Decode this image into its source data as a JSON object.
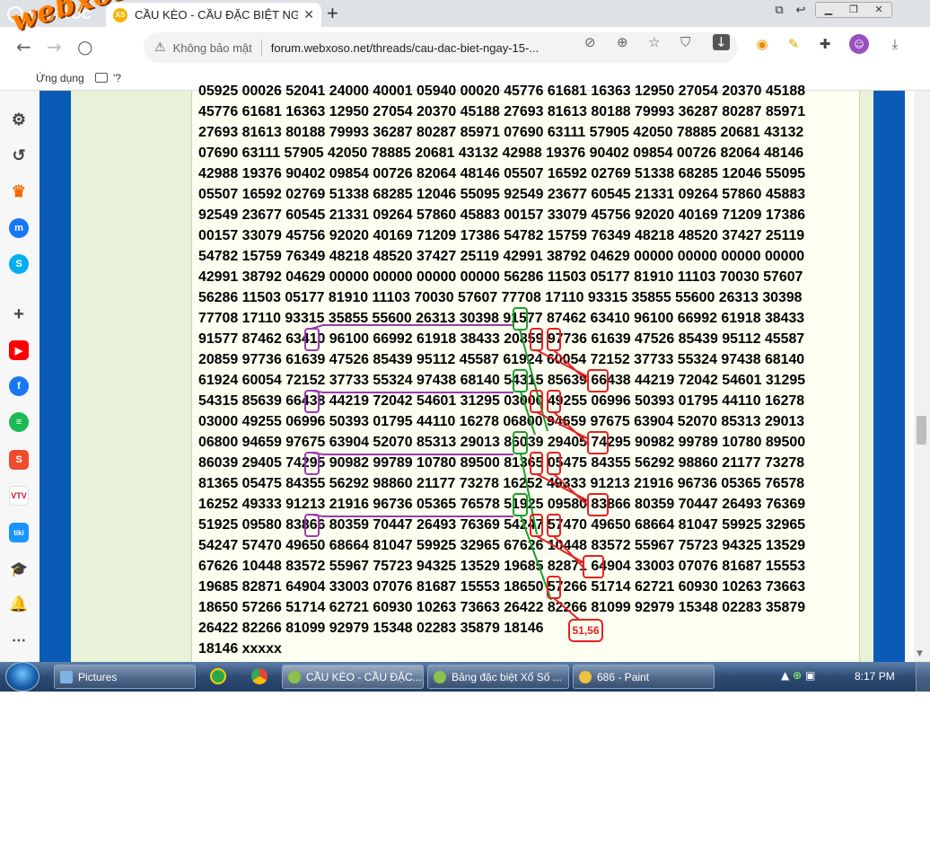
{
  "browser": {
    "name": "CỐC CỐC",
    "tab_title": "CẦU KÈO - CẦU ĐẶC BIỆT NG",
    "tab_favicon": "XS",
    "security_label": "Không bảo mật",
    "url": "forum.webxoso.net/threads/cau-dac-biet-ngay-15-...",
    "bookmark_label": "Ứng dụng",
    "bookmark_extra": "'?"
  },
  "watermark": "webxoso.net",
  "rows": [
    "05925 00026 52041 24000 40001 05940 00020 45776 61681 16363 12950 27054 20370 45188",
    "45776 61681 16363 12950 27054 20370 45188 27693 81613 80188 79993 36287 80287 85971",
    "27693 81613 80188 79993 36287 80287 85971 07690 63111 57905 42050 78885 20681 43132",
    "07690 63111 57905 42050 78885 20681 43132 42988 19376 90402 09854 00726 82064 48146",
    "42988 19376 90402 09854 00726 82064 48146 05507 16592 02769 51338 68285 12046 55095",
    "05507 16592 02769 51338 68285 12046 55095 92549 23677 60545 21331 09264 57860 45883",
    "92549 23677 60545 21331 09264 57860 45883 00157 33079 45756 92020 40169 71209 17386",
    "00157 33079 45756 92020 40169 71209 17386 54782 15759 76349 48218 48520 37427 25119",
    "54782 15759 76349 48218 48520 37427 25119 42991 38792 04629 00000 00000 00000 00000",
    "42991 38792 04629 00000 00000 00000 00000 56286 11503 05177 81910 11103 70030 57607",
    "56286 11503 05177 81910 11103 70030 57607 77708 17110 93315 35855 55600 26313 30398",
    "77708 17110 93315 35855 55600 26313 30398 91577 87462 63410 96100 66992 61918 38433",
    "91577 87462 63410 96100 66992 61918 38433 20859 97736 61639 47526 85439 95112 45587",
    "20859 97736 61639 47526 85439 95112 45587 61924 60054 72152 37733 55324 97438 68140",
    "61924 60054 72152 37733 55324 97438 68140 54315 85639 66438 44219 72042 54601 31295",
    "54315 85639 66438 44219 72042 54601 31295 03000 49255 06996 50393 01795 44110 16278",
    "03000 49255 06996 50393 01795 44110 16278 06800 94659 97675 63904 52070 85313 29013",
    "06800 94659 97675 63904 52070 85313 29013 86039 29405 74295 90982 99789 10780 89500",
    "86039 29405 74295 90982 99789 10780 89500 81365 05475 84355 56292 98860 21177 73278",
    "81365 05475 84355 56292 98860 21177 73278 16252 49333 91213 21916 96736 05365 76578",
    "16252 49333 91213 21916 96736 05365 76578 51925 09580 83866 80359 70447 26493 76369",
    "51925 09580 83866 80359 70447 26493 76369 54247 57470 49650 68664 81047 59925 32965",
    "54247 57470 49650 68664 81047 59925 32965 67626 10448 83572 55967 75723 94325 13529",
    "67626 10448 83572 55967 75723 94325 13529 19685 82871 64904 33003 07076 81687 15553",
    "19685 82871 64904 33003 07076 81687 15553 18650 57266 51714 62721 60930 10263 73663",
    "18650 57266 51714 62721 60930 10263 73663 26422 82266 81099 92979 15348 02283 35879",
    "26422 82266 81099 92979 15348 02283 35879 18146",
    "18146 xxxxx"
  ],
  "result_label": "51,56",
  "annotation_colors": {
    "green": "#1e9e2e",
    "purple": "#9b3cb0",
    "red": "#e52222"
  },
  "taskbar": {
    "items": [
      "Pictures",
      "CẦU KÈO - CẦU ĐẶC...",
      "Bảng đặc biệt Xổ Số ...",
      "686 - Paint"
    ],
    "clock": "8:17 PM"
  }
}
